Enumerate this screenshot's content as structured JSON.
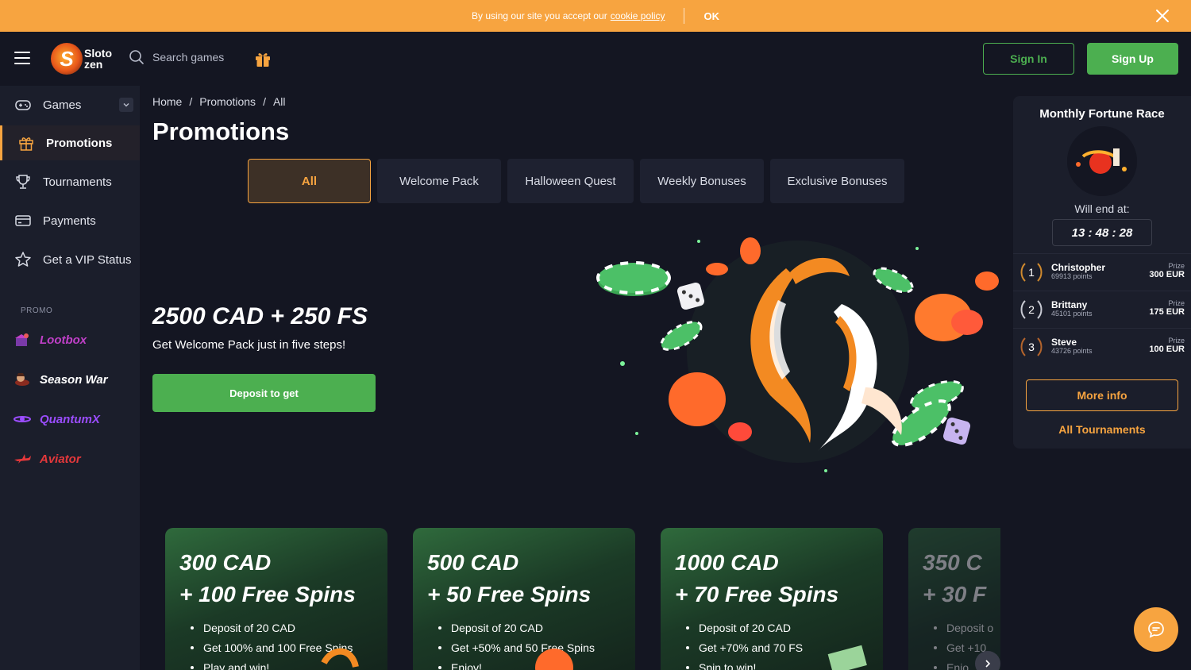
{
  "cookie": {
    "text": "By using our site you accept our",
    "link": "cookie policy",
    "ok": "OK"
  },
  "header": {
    "logo_line1": "Sloto",
    "logo_line2": "zen",
    "logo_letter": "S",
    "search_placeholder": "Search games",
    "sign_in": "Sign In",
    "sign_up": "Sign Up"
  },
  "sidebar": {
    "items": [
      {
        "label": "Games",
        "icon": "gamepad-icon"
      },
      {
        "label": "Promotions",
        "icon": "gift-icon"
      },
      {
        "label": "Tournaments",
        "icon": "trophy-icon"
      },
      {
        "label": "Payments",
        "icon": "card-icon"
      },
      {
        "label": "Get a VIP Status",
        "icon": "star-icon"
      }
    ],
    "promo_title": "PROMO",
    "promo_items": [
      {
        "label": "Lootbox",
        "color": "#c040c8"
      },
      {
        "label": "Season War",
        "color": "#ffffff"
      },
      {
        "label": "QuantumX",
        "color": "#9b4dff"
      },
      {
        "label": "Aviator",
        "color": "#e5383b"
      }
    ]
  },
  "breadcrumb": [
    "Home",
    "Promotions",
    "All"
  ],
  "page_title": "Promotions",
  "tabs": [
    "All",
    "Welcome Pack",
    "Halloween Quest",
    "Weekly Bonuses",
    "Exclusive Bonuses"
  ],
  "hero": {
    "title": "2500 CAD + 250 FS",
    "subtitle": "Get Welcome Pack just in five steps!",
    "button": "Deposit to get"
  },
  "cards": [
    {
      "line1": "300 CAD",
      "line2": "+ 100 Free Spins",
      "items": [
        "Deposit of 20 CAD",
        "Get 100% and 100 Free Spins",
        "Play and win!"
      ]
    },
    {
      "line1": "500 CAD",
      "line2": "+ 50 Free Spins",
      "items": [
        "Deposit of 20 CAD",
        "Get +50% and 50 Free Spins",
        "Enjoy!"
      ]
    },
    {
      "line1": "1000 CAD",
      "line2": "+ 70 Free Spins",
      "items": [
        "Deposit of 20 CAD",
        "Get +70% and 70 FS",
        "Spin to win!"
      ]
    },
    {
      "line1": "350 C",
      "line2": "+ 30 F",
      "items": [
        "Deposit o",
        "Get +10",
        "Enjo"
      ]
    }
  ],
  "race": {
    "title": "Monthly Fortune Race",
    "end_label": "Will end at:",
    "timer": "13 : 48 : 28",
    "prize_label": "Prize",
    "leaders": [
      {
        "rank": "1",
        "name": "Christopher",
        "points": "69913 points",
        "prize": "300 EUR",
        "color": "#d08a2e"
      },
      {
        "rank": "2",
        "name": "Brittany",
        "points": "45101 points",
        "prize": "175 EUR",
        "color": "#c9cbd4"
      },
      {
        "rank": "3",
        "name": "Steve",
        "points": "43726 points",
        "prize": "100 EUR",
        "color": "#b5652c"
      }
    ],
    "more_info": "More info",
    "all_tournaments": "All Tournaments"
  },
  "colors": {
    "accent": "#f7a440",
    "green": "#4caf50",
    "background": "#141622",
    "sidebar": "#1b1e2b"
  }
}
